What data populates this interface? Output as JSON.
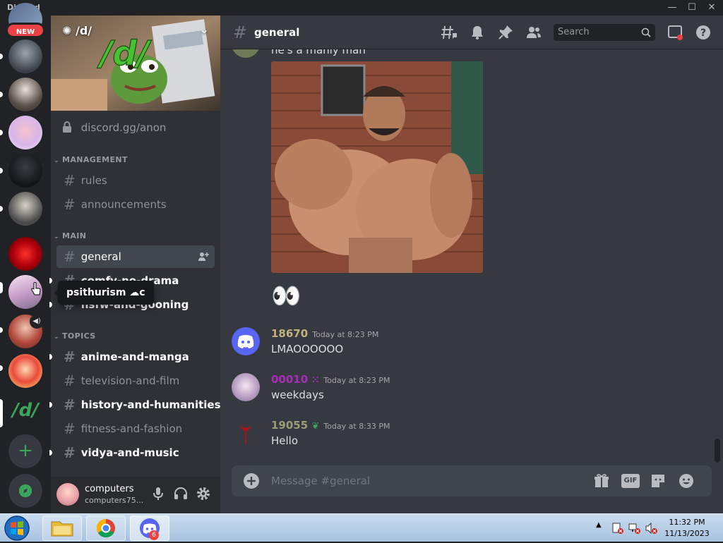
{
  "window": {
    "brand": "Discord",
    "controls": [
      "—",
      "☐",
      "✕"
    ]
  },
  "rail": {
    "new_badge": "NEW",
    "server_d_label": "/d/"
  },
  "tooltip": {
    "text": "psithurism ☁c"
  },
  "server": {
    "name": "/d/",
    "invite": "discord.gg/anon",
    "categories": [
      {
        "name": "MANAGEMENT",
        "channels": [
          {
            "name": "rules",
            "state": "muted"
          },
          {
            "name": "announcements",
            "state": "muted"
          }
        ]
      },
      {
        "name": "MAIN",
        "channels": [
          {
            "name": "general",
            "state": "active"
          },
          {
            "name": "comfy-no-drama",
            "state": "unread"
          },
          {
            "name": "nsfw-and-gooning",
            "state": "unread"
          }
        ]
      },
      {
        "name": "TOPICS",
        "channels": [
          {
            "name": "anime-and-manga",
            "state": "unread"
          },
          {
            "name": "television-and-film",
            "state": "muted"
          },
          {
            "name": "history-and-humanities",
            "state": "unread"
          },
          {
            "name": "fitness-and-fashion",
            "state": "muted"
          },
          {
            "name": "vidya-and-music",
            "state": "unread"
          }
        ]
      }
    ]
  },
  "user": {
    "name": "computers",
    "tag": "computers75..."
  },
  "channel_header": {
    "name": "general",
    "search_placeholder": "Search",
    "icons": [
      "threads-icon",
      "bell-icon",
      "pin-icon",
      "members-icon",
      "inbox-icon",
      "help-icon"
    ]
  },
  "messages": [
    {
      "author": "",
      "time": "",
      "text": "he's a manly man",
      "has_image": true,
      "emoji": "👀"
    },
    {
      "author": "18670",
      "time": "Today at 8:23 PM",
      "text": "LMAOOOOOO",
      "author_color": "#c2b280"
    },
    {
      "author": "00010",
      "author_suffix": "⁙",
      "time": "Today at 8:23 PM",
      "text": "weekdays",
      "author_color": "#a82dbb"
    },
    {
      "author": "19055",
      "author_suffix": "❦",
      "time": "Today at 8:33 PM",
      "text": "Hello",
      "author_color": "#9c9c7a"
    }
  ],
  "composer": {
    "placeholder": "Message #general",
    "gif_label": "GIF"
  },
  "taskbar": {
    "time": "11:32 PM",
    "date": "11/13/2023",
    "discord_badge": "6"
  }
}
